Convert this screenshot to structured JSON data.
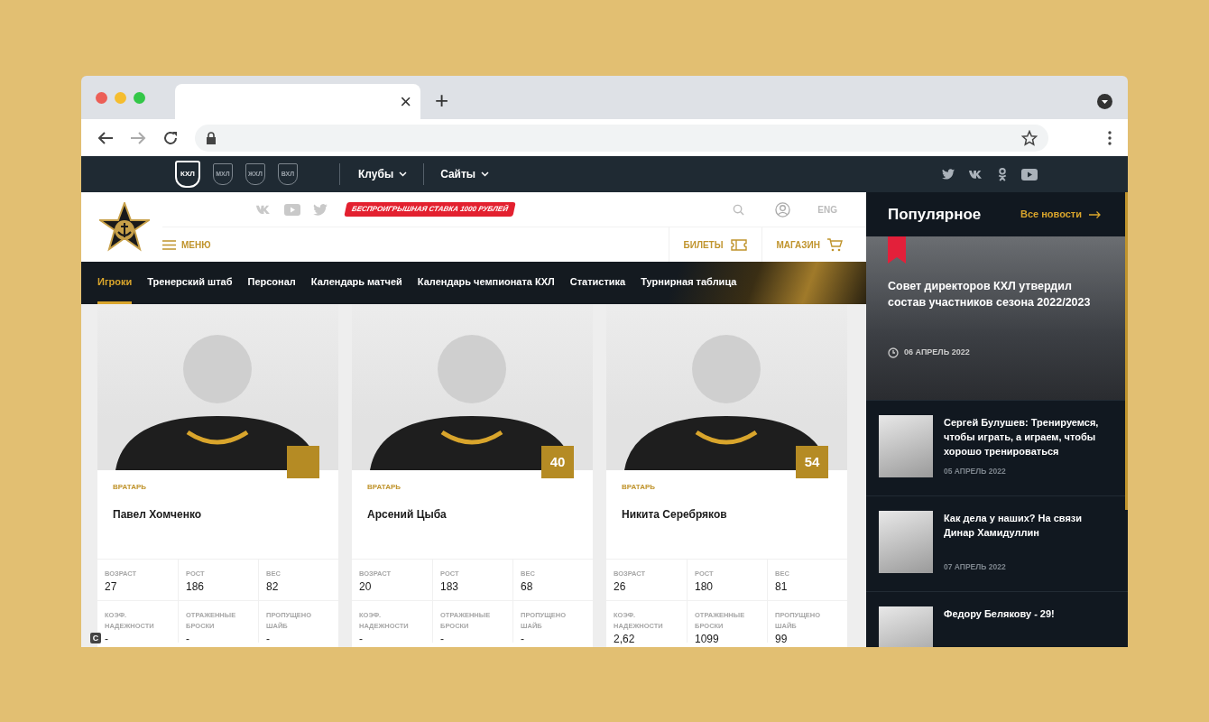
{
  "browser": {
    "tab_close": "×",
    "new_tab": "+"
  },
  "top_bar": {
    "leagues": [
      "КХЛ",
      "МХЛ",
      "ЖХЛ",
      "ВХЛ"
    ],
    "menus": [
      "Клубы",
      "Сайты"
    ]
  },
  "header": {
    "promo": "БЕСПРОИГРЫШНАЯ СТАВКА 1000 РУБЛЕЙ",
    "language": "ENG",
    "menu": "МЕНЮ",
    "links": [
      {
        "label": "БИЛЕТЫ",
        "kind": "ticket"
      },
      {
        "label": "МАГАЗИН",
        "kind": "cart"
      }
    ]
  },
  "nav": [
    {
      "label": "Игроки",
      "selected": true
    },
    {
      "label": "Тренерский штаб",
      "selected": false
    },
    {
      "label": "Персонал",
      "selected": false
    },
    {
      "label": "Календарь матчей",
      "selected": false
    },
    {
      "label": "Календарь чемпионата КХЛ",
      "selected": false
    },
    {
      "label": "Статистика",
      "selected": false
    },
    {
      "label": "Турнирная таблица",
      "selected": false
    }
  ],
  "players": [
    {
      "position": "ВРАТАРЬ",
      "name": "Павел Хомченко",
      "stats": [
        {
          "label": "ВОЗРАСТ",
          "value": "27"
        },
        {
          "label": "РОСТ",
          "value": "186"
        },
        {
          "label": "ВЕС",
          "value": "82"
        },
        {
          "label": "КОЭФ. НАДЕЖНОСТИ",
          "value": "-"
        },
        {
          "label": "ОТРАЖЕННЫЕ БРОСКИ",
          "value": "-"
        },
        {
          "label": "ПРОПУЩЕНО ШАЙБ",
          "value": "-"
        }
      ]
    },
    {
      "position": "ВРАТАРЬ",
      "name": "Арсений Цыба",
      "number": "40",
      "stats": [
        {
          "label": "ВОЗРАСТ",
          "value": "20"
        },
        {
          "label": "РОСТ",
          "value": "183"
        },
        {
          "label": "ВЕС",
          "value": "68"
        },
        {
          "label": "КОЭФ. НАДЕЖНОСТИ",
          "value": "-"
        },
        {
          "label": "ОТРАЖЕННЫЕ БРОСКИ",
          "value": "-"
        },
        {
          "label": "ПРОПУЩЕНО ШАЙБ",
          "value": "-"
        }
      ]
    },
    {
      "position": "ВРАТАРЬ",
      "name": "Никита Серебряков",
      "number": "54",
      "stats": [
        {
          "label": "ВОЗРАСТ",
          "value": "26"
        },
        {
          "label": "РОСТ",
          "value": "180"
        },
        {
          "label": "ВЕС",
          "value": "81"
        },
        {
          "label": "КОЭФ. НАДЕЖНОСТИ",
          "value": "2,62"
        },
        {
          "label": "ОТРАЖЕННЫЕ БРОСКИ",
          "value": "1099"
        },
        {
          "label": "ПРОПУЩЕНО ШАЙБ",
          "value": "99"
        }
      ]
    }
  ],
  "corner_badge": "C",
  "popular": {
    "title": "Популярное",
    "all_link": "Все новости",
    "featured": {
      "title": "Совет директоров КХЛ утвердил состав участников сезона 2022/2023",
      "date": "06 АПРЕЛЬ 2022"
    },
    "items": [
      {
        "title": "Сергей Булушев: Тренируемся, чтобы играть, а играем, чтобы хорошо тренироваться",
        "date": "05 АПРЕЛЬ 2022"
      },
      {
        "title": "Как дела у наших? На связи Динар Хамидуллин",
        "date": "07 АПРЕЛЬ 2022"
      },
      {
        "title": "Федору Белякову - 29!"
      }
    ]
  }
}
